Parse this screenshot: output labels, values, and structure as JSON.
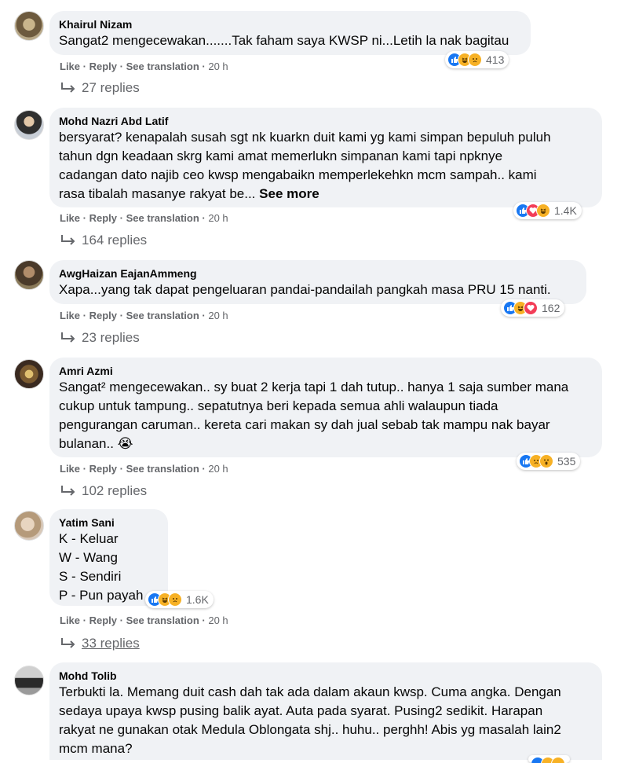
{
  "actions": {
    "like": "Like",
    "reply": "Reply",
    "see_translation": "See translation",
    "sep": "·"
  },
  "comments": [
    {
      "author": "Khairul Nizam",
      "lines": [
        "Sangat2 mengecewakan.......Tak faham saya KWSP ni...Letih la nak bagitau"
      ],
      "reactions": [
        "like",
        "haha",
        "sad"
      ],
      "reaction_count": "413",
      "time": "20 h",
      "replies": "27 replies"
    },
    {
      "author": "Mohd Nazri Abd Latif",
      "lines": [
        "bersyarat? kenapalah susah sgt nk kuarkn duit kami yg kami simpan bepuluh puluh",
        "tahun dgn keadaan skrg kami amat memerlukn simpanan kami tapi npknye",
        "cadangan dato najib ceo kwsp mengabaikn memperlekehkn mcm sampah.. kami",
        "rasa tibalah masanye rakyat be..."
      ],
      "see_more": "See more",
      "reactions": [
        "like",
        "love",
        "haha"
      ],
      "reaction_count": "1.4K",
      "time": "20 h",
      "replies": "164 replies"
    },
    {
      "author": "AwgHaizan EajanAmmeng",
      "lines": [
        "Xapa...yang tak dapat pengeluaran pandai-pandailah pangkah masa PRU 15 nanti."
      ],
      "reactions": [
        "like",
        "haha",
        "love"
      ],
      "reaction_count": "162",
      "time": "20 h",
      "replies": "23 replies"
    },
    {
      "author": "Amri Azmi",
      "lines": [
        "Sangat² mengecewakan.. sy buat 2 kerja tapi 1 dah tutup.. hanya 1 saja sumber mana",
        "cukup untuk tampung.. sepatutnya beri kepada semua ahli walaupun tiada",
        "pengurangan caruman.. kereta cari makan sy dah jual sebab tak mampu nak bayar",
        "bulanan.. 😭"
      ],
      "reactions": [
        "like",
        "sad",
        "wow"
      ],
      "reaction_count": "535",
      "time": "20 h",
      "replies": "102 replies"
    },
    {
      "author": "Yatim Sani",
      "lines": [
        "K - Keluar",
        "W - Wang",
        "S - Sendiri",
        "P - Pun payah"
      ],
      "reactions": [
        "like",
        "haha",
        "sad"
      ],
      "reaction_count": "1.6K",
      "time": "20 h",
      "replies": "33 replies"
    },
    {
      "author": "Mohd Tolib",
      "lines": [
        "Terbukti la. Memang duit cash dah tak ada dalam akaun kwsp. Cuma angka. Dengan",
        "sedaya upaya kwsp pusing balik ayat. Auta pada syarat. Pusing2 sedikit. Harapan",
        "rakyat ne gunakan otak Medula Oblongata shj.. huhu.. perghh! Abis yg masalah lain2",
        "mcm mana?"
      ],
      "reactions": [
        "like",
        "haha",
        "sad"
      ]
    }
  ],
  "colors": {
    "bubble": "#f0f2f5",
    "meta": "#65676b",
    "like": "#1877f2",
    "love": "#f33e58",
    "emoji": "#f7b125"
  }
}
